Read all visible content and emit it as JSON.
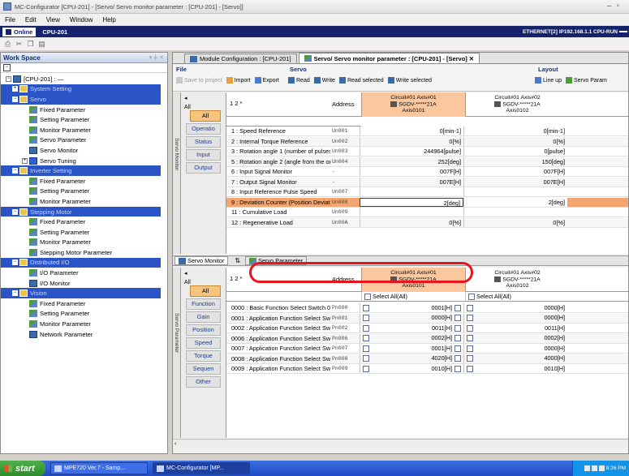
{
  "window": {
    "title": "MC-Configurator [CPU-201] - [Servo/ Servo monitor parameter : [CPU-201] - [Servo]]"
  },
  "menu": [
    "File",
    "Edit",
    "View",
    "Window",
    "Help"
  ],
  "status": {
    "online_label": "Online",
    "cpu_label": "CPU-201",
    "connection": "ETHERNET[2] IP192.168.1.1 CPU-RUN"
  },
  "workspace": {
    "title": "Work Space",
    "pin": "▾ ╪ ✕",
    "root": "[CPU-201] : —",
    "items": [
      {
        "label": "System Setting",
        "level": 1,
        "type": "section",
        "toggle": "+"
      },
      {
        "label": "Servo",
        "level": 1,
        "type": "section",
        "toggle": "−"
      },
      {
        "label": "Fixed Parameter",
        "level": 2,
        "type": "param"
      },
      {
        "label": "Setting Parameter",
        "level": 2,
        "type": "param"
      },
      {
        "label": "Monitor Parameter",
        "level": 2,
        "type": "param"
      },
      {
        "label": "Servo Parameter",
        "level": 2,
        "type": "param"
      },
      {
        "label": "Servo Monitor",
        "level": 2,
        "type": "monitor"
      },
      {
        "label": "Servo Tuning",
        "level": 2,
        "type": "blue",
        "toggle": "+"
      },
      {
        "label": "Inverter Setting",
        "level": 1,
        "type": "section",
        "toggle": "−"
      },
      {
        "label": "Fixed Parameter",
        "level": 2,
        "type": "param"
      },
      {
        "label": "Setting Parameter",
        "level": 2,
        "type": "param"
      },
      {
        "label": "Monitor Parameter",
        "level": 2,
        "type": "param"
      },
      {
        "label": "Stepping Motor",
        "level": 1,
        "type": "section",
        "toggle": "−"
      },
      {
        "label": "Fixed Parameter",
        "level": 2,
        "type": "param"
      },
      {
        "label": "Setting Parameter",
        "level": 2,
        "type": "param"
      },
      {
        "label": "Monitor Parameter",
        "level": 2,
        "type": "param"
      },
      {
        "label": "Stepping Motor Parameter",
        "level": 2,
        "type": "param"
      },
      {
        "label": "Distributed I/O",
        "level": 1,
        "type": "section",
        "toggle": "−"
      },
      {
        "label": "I/O Parameter",
        "level": 2,
        "type": "param"
      },
      {
        "label": "I/O Monitor",
        "level": 2,
        "type": "monitor"
      },
      {
        "label": "Vision",
        "level": 1,
        "type": "section",
        "toggle": "−"
      },
      {
        "label": "Fixed Parameter",
        "level": 2,
        "type": "param"
      },
      {
        "label": "Setting Parameter",
        "level": 2,
        "type": "param"
      },
      {
        "label": "Monitor Parameter",
        "level": 2,
        "type": "param"
      },
      {
        "label": "Network Parameter",
        "level": 2,
        "type": "monitor"
      }
    ]
  },
  "doc_tabs": [
    {
      "label": "Module Configuration : [CPU-201]",
      "active": false
    },
    {
      "label": "Servo/ Servo monitor parameter : [CPU-201] - [Servo]",
      "active": true
    }
  ],
  "ribbon": {
    "file_group": "File",
    "file_items": [
      "Save to project",
      "Import",
      "Export"
    ],
    "servo_group": "Servo",
    "servo_items": [
      "Read",
      "Write",
      "Read selected",
      "Write selected"
    ],
    "layout_group": "Layout",
    "layout_items": [
      "Line up",
      "Servo Param"
    ]
  },
  "monitor_pane": {
    "side_label": "Servo Monitor",
    "all_label": "All",
    "filters": [
      "All",
      "Operatio",
      "Status",
      "Input",
      "Output"
    ],
    "cols_header": "1 2 *",
    "address_header": "Address",
    "axes": [
      {
        "line1": "Circuit#01 Axis#01",
        "line2": "SGDV-*****21A",
        "line3": "Axis0101"
      },
      {
        "line1": "Circuit#01 Axis#02",
        "line2": "SGDV-*****21A",
        "line3": "Axis0102"
      }
    ],
    "rows": [
      {
        "name": "1 : Speed Reference",
        "address": "Un001",
        "v1": "0[min-1]",
        "v2": "0[min-1]"
      },
      {
        "name": "2 : Internal Torque Reference",
        "address": "Un002",
        "v1": "0[%]",
        "v2": "0[%]"
      },
      {
        "name": "3 : Rotation angle 1 (number of pulses...",
        "address": "Un003",
        "v1": "244964[pulse]",
        "v2": "0[pulse]"
      },
      {
        "name": "5 : Rotation angle 2 (angle from the ori...",
        "address": "Un004",
        "v1": "252[deg]",
        "v2": "150[deg]"
      },
      {
        "name": "6 : Input Signal Monitor",
        "address": "-",
        "v1": "007F[H]",
        "v2": "007F[H]"
      },
      {
        "name": "7 : Output Signal Monitor",
        "address": "-",
        "v1": "007E[H]",
        "v2": "007E[H]"
      },
      {
        "name": "8 : Input Reference Pulse Speed",
        "address": "Un007",
        "v1": "",
        "v2": ""
      },
      {
        "name": "9 : Deviation Counter (Position Deviati...",
        "address": "Un008",
        "v1": "2[deg]",
        "v2": "2[deg]"
      },
      {
        "name": "11 : Cumulative Load",
        "address": "Un009",
        "v1": "",
        "v2": ""
      },
      {
        "name": "12 : Regenerative Load",
        "address": "Un00A",
        "v1": "0[%]",
        "v2": "0[%]"
      }
    ]
  },
  "pane_tabs": {
    "monitor": "Servo Monitor",
    "swap": "⇅",
    "param": "Servo Parameter"
  },
  "param_pane": {
    "side_label": "Servo Parameter",
    "all_label": "All",
    "filters": [
      "All",
      "Function",
      "Gain",
      "Position",
      "Speed",
      "Torque",
      "Sequen",
      "Other"
    ],
    "cols_header": "1 2 *",
    "address_header": "Address",
    "select_all": "Select All(All)",
    "axes": [
      {
        "line1": "Circuit#01 Axis#01",
        "line2": "SGDV-*****21A",
        "line3": "Axis0101"
      },
      {
        "line1": "Circuit#01 Axis#02",
        "line2": "SGDV-*****21A",
        "line3": "Axis0102"
      }
    ],
    "rows": [
      {
        "name": "0000 : Basic Function Select Switch 0",
        "address": "Pn000",
        "v1": "0001[H]",
        "v2": "0000[H]"
      },
      {
        "name": "0001 : Application Function Select Swi...",
        "address": "Pn001",
        "v1": "0000[H]",
        "v2": "0000[H]"
      },
      {
        "name": "0002 : Application Function Select Swi...",
        "address": "Pn002",
        "v1": "0011[H]",
        "v2": "0011[H]"
      },
      {
        "name": "0006 : Application Function Select Swi...",
        "address": "Pn006",
        "v1": "0002[H]",
        "v2": "0002[H]"
      },
      {
        "name": "0007 : Application Function Select Swi...",
        "address": "Pn007",
        "v1": "0001[H]",
        "v2": "0000[H]"
      },
      {
        "name": "0008 : Application Function Select Swi...",
        "address": "Pn008",
        "v1": "4020[H]",
        "v2": "4000[H]"
      },
      {
        "name": "0009 : Application Function Select Swi...",
        "address": "Pn009",
        "v1": "0010[H]",
        "v2": "0010[H]"
      }
    ]
  },
  "taskbar": {
    "start": "start",
    "items": [
      "MPE720 Ver.7 - Samp...",
      "MC-Configurator [MP..."
    ],
    "clock": "8:26 PM"
  },
  "colors": {
    "status_bar": "#16236b",
    "section_header": "#2b55c7",
    "selected_axis": "#fbc79e",
    "highlight_row": "#f4a66e",
    "callout": "#e8141b"
  }
}
